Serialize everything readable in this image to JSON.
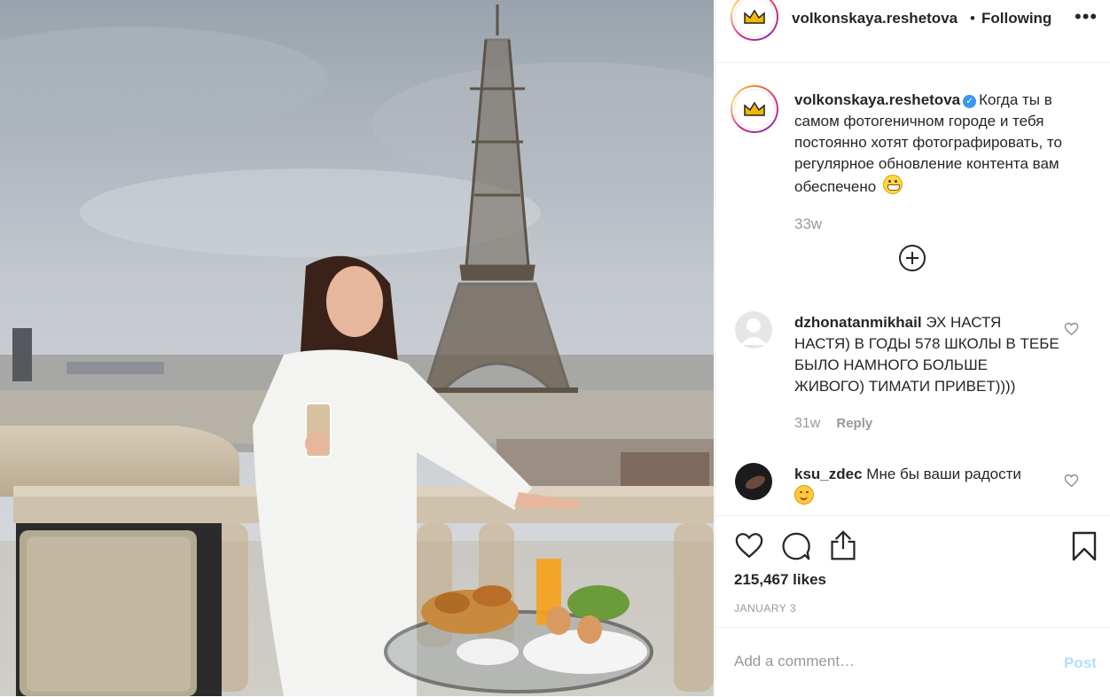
{
  "post": {
    "username": "volkonskaya.reshetova",
    "follow_dot": "•",
    "follow_status": "Following",
    "more_glyph": "•••",
    "caption": "Когда ты в самом фотогеничном городе и тебя постоянно хотят фотографировать, то регулярное обновление контента вам обеспечено",
    "caption_time": "33w",
    "likes": "215,467 likes",
    "date": "JANUARY 3"
  },
  "comments": [
    {
      "username": "dzhonatanmikhail",
      "text": "ЭХ НАСТЯ НАСТЯ) В ГОДЫ 578 ШКОЛЫ В ТЕБЕ БЫЛО НАМНОГО БОЛЬШЕ ЖИВОГО) ТИМАТИ ПРИВЕТ))))",
      "time": "31w",
      "reply_label": "Reply"
    },
    {
      "username": "ksu_zdec",
      "text": "Мне бы ваши радости"
    }
  ],
  "comment_box": {
    "placeholder": "Add a comment…",
    "post_label": "Post"
  },
  "icons": {
    "avatar": "crown-icon",
    "verified": "verified-badge-icon",
    "emoji_caption": "grinning-emoji",
    "emoji_comment": "smiling-emoji",
    "actions": [
      "heart-icon",
      "comment-icon",
      "share-icon",
      "bookmark-icon"
    ]
  },
  "colors": {
    "verified_blue": "#3897f0",
    "post_button_disabled": "#b2dffc",
    "muted_text": "#999999"
  }
}
